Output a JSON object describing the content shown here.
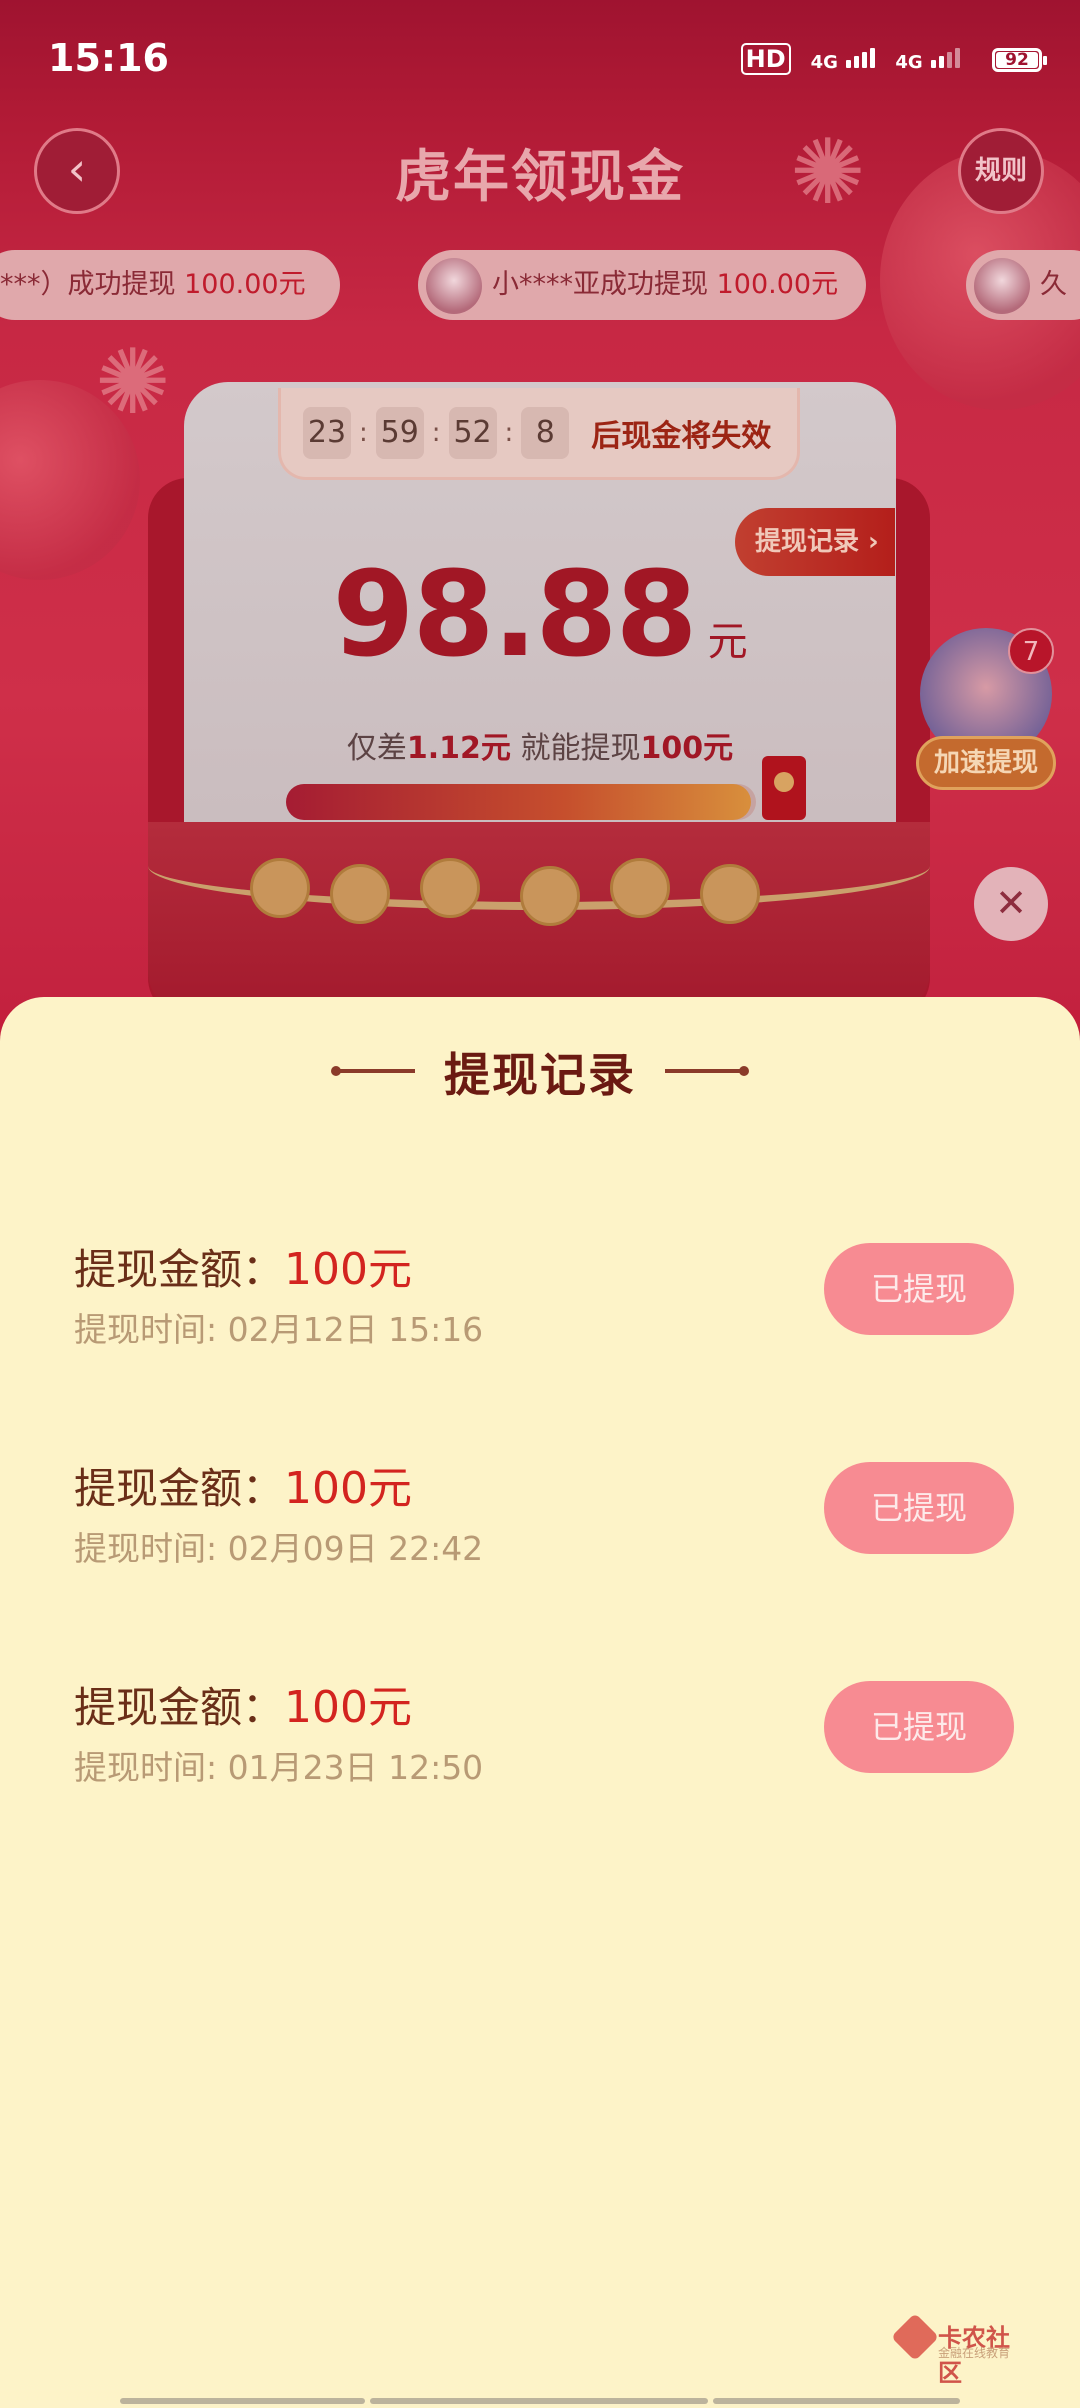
{
  "status_bar": {
    "time": "15:16",
    "hd_label": "HD",
    "network_1": "4G",
    "network_2": "4G",
    "battery": "92"
  },
  "header": {
    "back_icon": "‹",
    "title": "虎年领现金",
    "rules_label": "规则"
  },
  "ticker": [
    {
      "prefix": "***）成功提现 ",
      "amount": "100.00元"
    },
    {
      "prefix": "小****亚成功提现 ",
      "amount": "100.00元"
    },
    {
      "prefix": "久",
      "amount": ""
    }
  ],
  "countdown": {
    "hours": "23",
    "minutes": "59",
    "seconds": "52",
    "tenths": "8",
    "suffix": "后现金将失效"
  },
  "card": {
    "record_tab_label": "提现记录 ›",
    "amount": "98.88",
    "amount_unit": "元",
    "gap_prefix": "仅差",
    "gap_value": "1.12元",
    "gap_middle": " 就能提现",
    "gap_target": "100元",
    "progress_fraction": 0.9888
  },
  "boost": {
    "badge": "7",
    "label": "加速提现"
  },
  "close_icon": "✕",
  "sheet": {
    "title": "提现记录",
    "records": [
      {
        "amount_label": "提现金额：",
        "amount": "100元",
        "time": "提现时间: 02月12日 15:16",
        "status": "已提现"
      },
      {
        "amount_label": "提现金额：",
        "amount": "100元",
        "time": "提现时间: 02月09日 22:42",
        "status": "已提现"
      },
      {
        "amount_label": "提现金额：",
        "amount": "100元",
        "time": "提现时间: 01月23日 12:50",
        "status": "已提现"
      }
    ]
  },
  "watermark": {
    "name": "卡农社区",
    "sub": "金融在线教育"
  },
  "colors": {
    "accent_red": "#d3241f",
    "sheet_bg": "#fdf3c8",
    "status_button": "#f78b92"
  }
}
